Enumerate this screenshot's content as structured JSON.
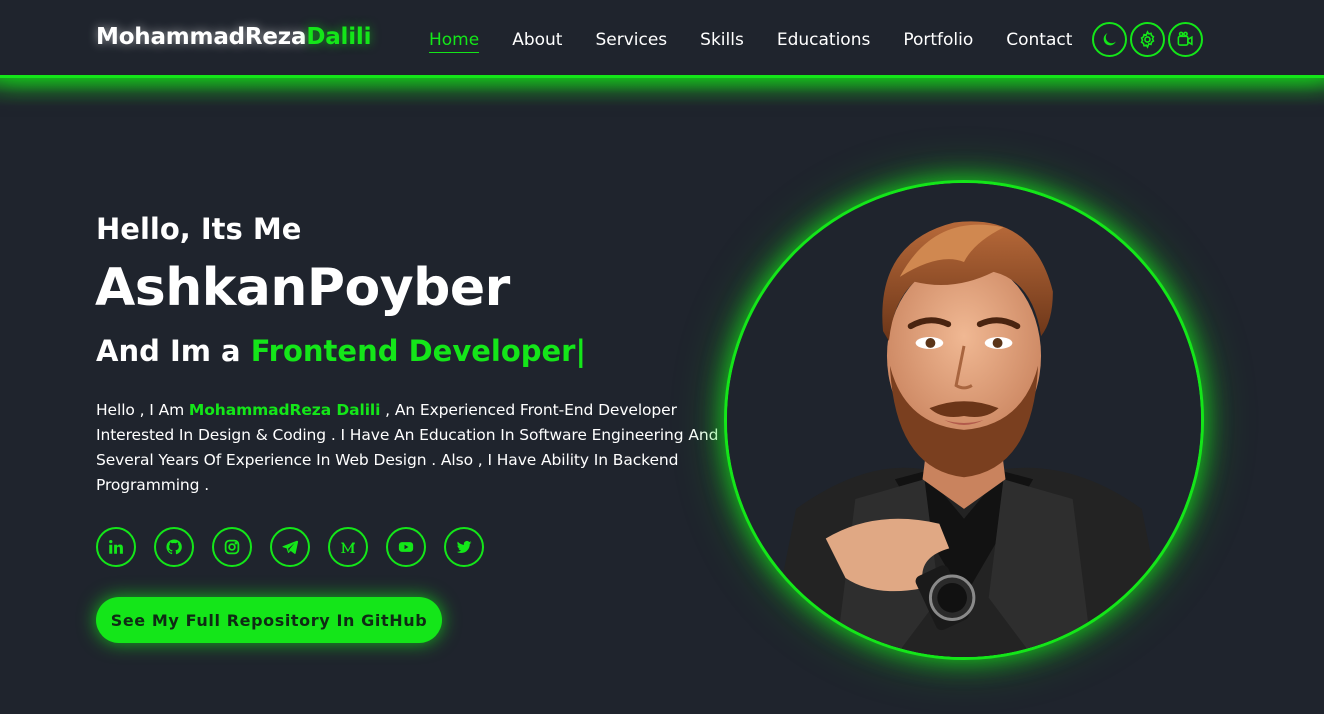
{
  "header": {
    "logo_first": "MohammadReza",
    "logo_accent": "Dalili",
    "nav": [
      {
        "label": "Home",
        "active": true
      },
      {
        "label": "About"
      },
      {
        "label": "Services"
      },
      {
        "label": "Skills"
      },
      {
        "label": "Educations"
      },
      {
        "label": "Portfolio"
      },
      {
        "label": "Contact"
      }
    ],
    "icons": [
      "moon-icon",
      "gear-icon",
      "video-camera-icon"
    ]
  },
  "hero": {
    "greeting": "Hello, Its Me",
    "name": "AshkanPoyber",
    "role_prefix": "And Im a ",
    "role_highlight": "Frontend Developer",
    "cursor": "|",
    "bio_start": "Hello , I Am ",
    "bio_name": "MohammadReza Dalili",
    "bio_rest": " , An Experienced Front-End Developer Interested In Design & Coding . I Have An Education In Software Engineering And Several Years Of Experience In Web Design . Also , I Have Ability In Backend Programming .",
    "socials": [
      "linkedin-icon",
      "github-icon",
      "instagram-icon",
      "telegram-icon",
      "medium-icon",
      "youtube-icon",
      "twitter-icon"
    ],
    "cta_label": "See My Full Repository In GitHub"
  },
  "colors": {
    "background": "#1f242d",
    "accent": "#14e619",
    "text": "#ffffff"
  }
}
